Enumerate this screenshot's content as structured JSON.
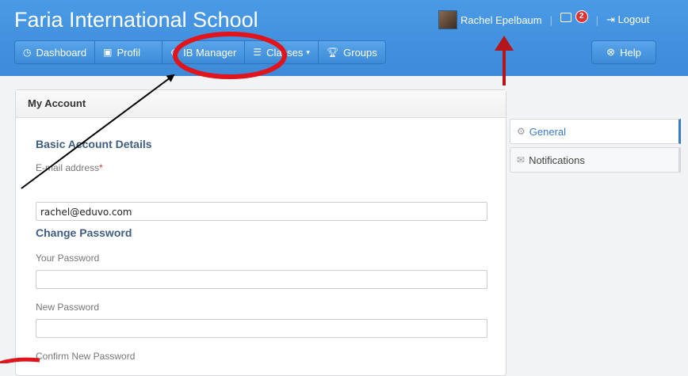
{
  "header": {
    "school_name": "Faria International School",
    "user_name": "Rachel Epelbaum",
    "message_count": "2",
    "logout_label": "Logout"
  },
  "nav": {
    "items": [
      {
        "label": "Dashboard",
        "icon": "dashboard-icon"
      },
      {
        "label": "Profil",
        "icon": "profile-icon"
      },
      {
        "label": "IB Manager",
        "icon": "globe-icon"
      },
      {
        "label": "Classes",
        "icon": "list-icon"
      },
      {
        "label": "Groups",
        "icon": "trophy-icon"
      }
    ],
    "help_label": "Help"
  },
  "account": {
    "title": "My Account",
    "basic_section": "Basic Account Details",
    "email_label": "E-mail address",
    "email_value": "rachel@eduvo.com",
    "password_section": "Change Password",
    "your_password_label": "Your Password",
    "new_password_label": "New Password",
    "confirm_password_label": "Confirm New Password"
  },
  "side_tabs": [
    {
      "label": "General",
      "icon": "gear-icon",
      "active": true
    },
    {
      "label": "Notifications",
      "icon": "envelope-icon",
      "active": false
    }
  ],
  "colors": {
    "header_blue": "#3d8ad8",
    "annotation_red": "#e0141b",
    "arrow_dark_red": "#b3151a",
    "arrow_black": "#000000"
  }
}
